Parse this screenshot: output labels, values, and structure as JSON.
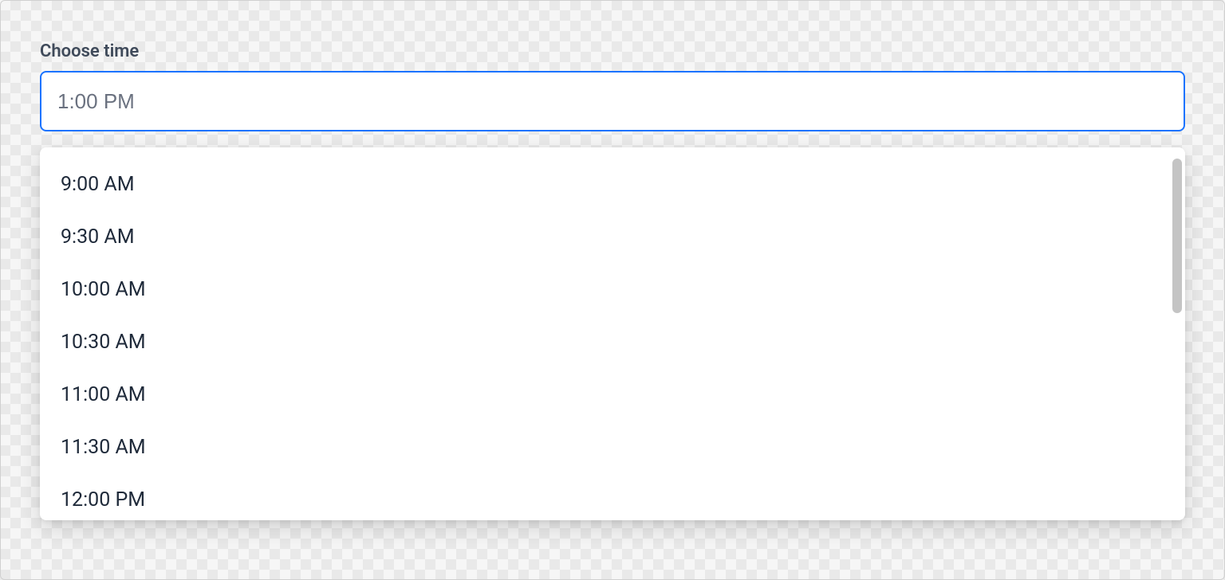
{
  "picker": {
    "label": "Choose time",
    "placeholder": "1:00 PM",
    "value": "",
    "options": [
      "9:00 AM",
      "9:30 AM",
      "10:00 AM",
      "10:30 AM",
      "11:00 AM",
      "11:30 AM",
      "12:00 PM"
    ]
  }
}
